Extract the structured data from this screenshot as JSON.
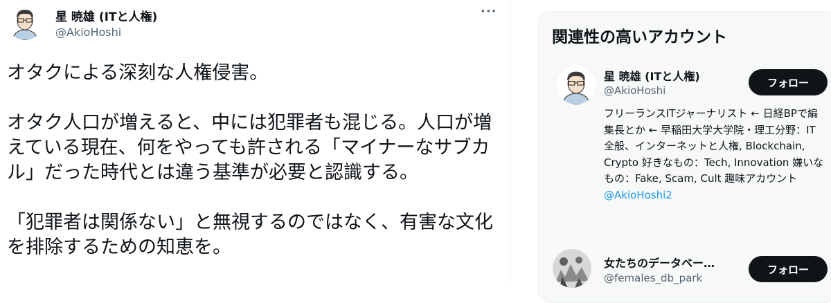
{
  "tweet": {
    "display_name": "星 暁雄 (ITと人権)",
    "handle": "@AkioHoshi",
    "more_label": "···",
    "paragraphs": [
      "オタクによる深刻な人権侵害。",
      "オタク人口が増えると、中には犯罪者も混じる。人口が増えている現在、何をやっても許される「マイナーなサブカル」だった時代とは違う基準が必要と認識する。",
      "「犯罪者は関係ない」と無視するのではなく、有害な文化を排除するための知恵を。"
    ]
  },
  "sidebar": {
    "title": "関連性の高いアカウント",
    "accounts": [
      {
        "name": "星 暁雄 (ITと人権)",
        "handle": "@AkioHoshi",
        "follow_label": "フォロー",
        "bio": "フリーランスITジャーナリスト ← 日経BPで編集長とか ← 早稲田大学大学院・理工分野：IT全般、インターネットと人権, Blockchain, Crypto 好きなもの：Tech, Innovation 嫌いなもの：Fake, Scam, Cult 趣味アカウント",
        "bio_link": "@AkioHoshi2"
      },
      {
        "name": "女たちのデータベー…",
        "handle": "@females_db_park",
        "follow_label": "フォロー"
      }
    ]
  },
  "colors": {
    "text": "#0f1419",
    "muted": "#536471",
    "link": "#1d9bf0",
    "button": "#0f1419",
    "card_bg": "#f7f9f9"
  }
}
